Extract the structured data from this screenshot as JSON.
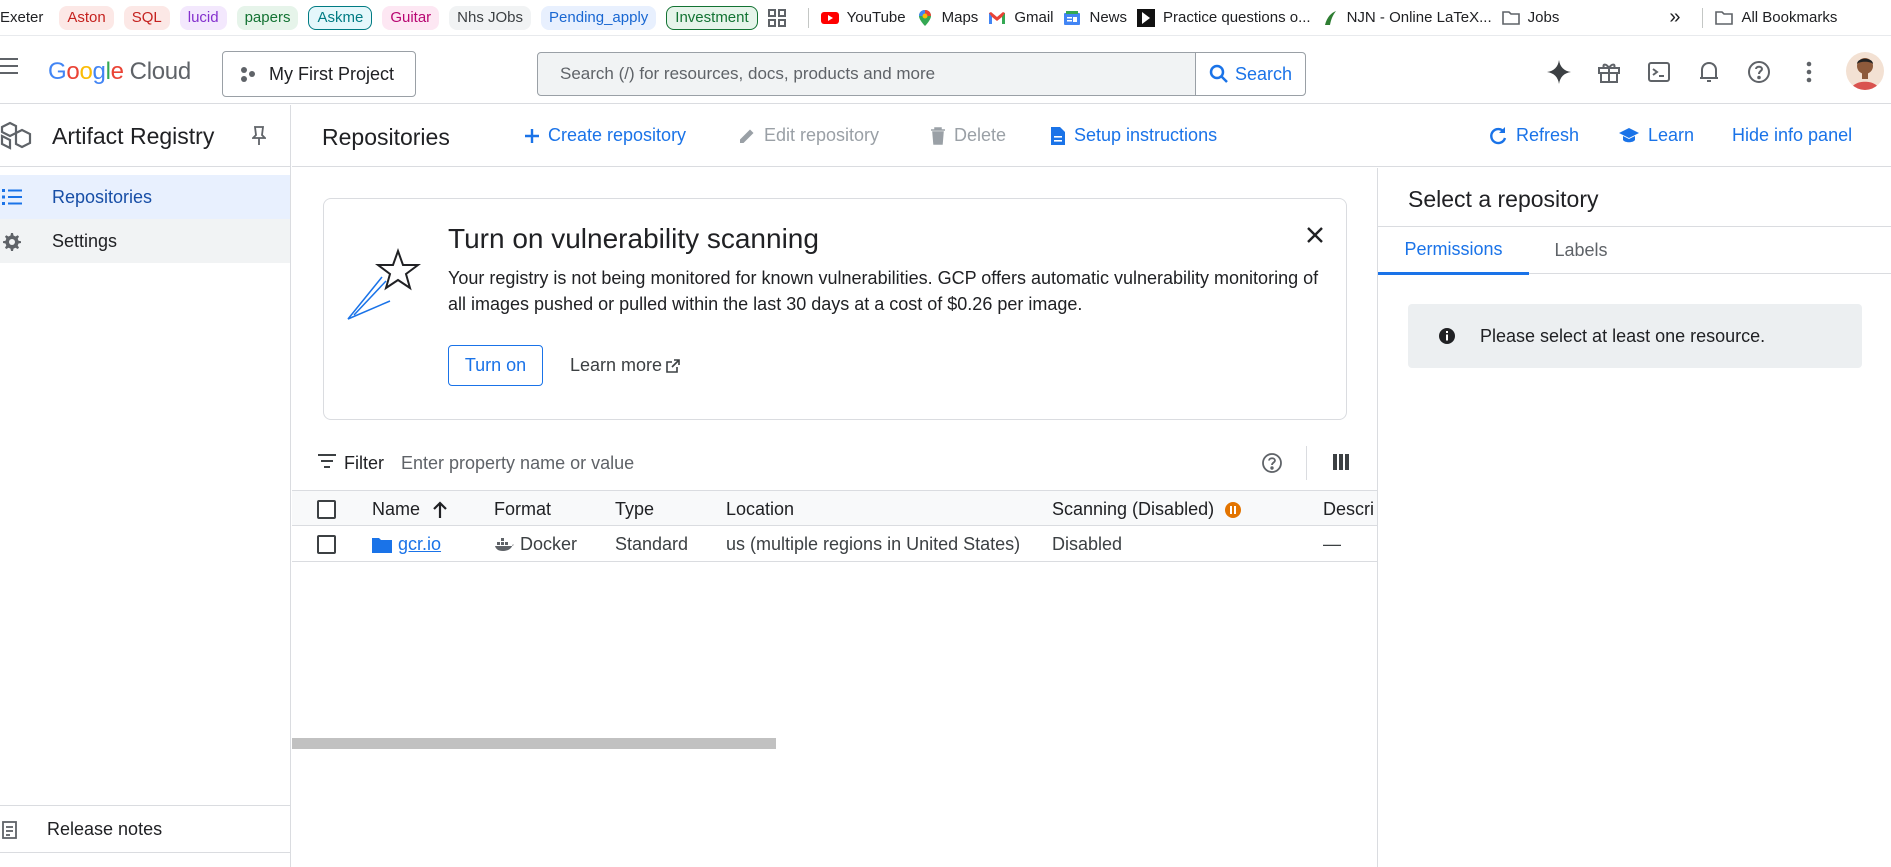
{
  "bookmarks": {
    "items": [
      {
        "label": "Exeter",
        "color": "",
        "bg": "",
        "border": ""
      },
      {
        "label": "Aston",
        "color": "#c5221f",
        "bg": "#fce8e6",
        "border": ""
      },
      {
        "label": "SQL",
        "color": "#c5221f",
        "bg": "#fce8e6",
        "border": ""
      },
      {
        "label": "lucid",
        "color": "#8430ce",
        "bg": "#f3e8fd",
        "border": ""
      },
      {
        "label": "papers",
        "color": "#137333",
        "bg": "#e6f4ea",
        "border": ""
      },
      {
        "label": "Askme",
        "color": "#007b83",
        "bg": "#e4f7fb",
        "border": "#007b83"
      },
      {
        "label": "Guitar",
        "color": "#b80672",
        "bg": "#fde7f3",
        "border": ""
      },
      {
        "label": "Nhs JObs",
        "color": "#3c4043",
        "bg": "#f1f3f4",
        "border": ""
      },
      {
        "label": "Pending_apply",
        "color": "#1967d2",
        "bg": "#e8f0fe",
        "border": ""
      },
      {
        "label": "Investment",
        "color": "#137333",
        "bg": "#e6f4ea",
        "border": "#137333"
      }
    ],
    "links": [
      {
        "label": "YouTube",
        "icon": "youtube-icon"
      },
      {
        "label": "Maps",
        "icon": "maps-icon"
      },
      {
        "label": "Gmail",
        "icon": "gmail-icon"
      },
      {
        "label": "News",
        "icon": "news-icon"
      },
      {
        "label": "Practice questions o...",
        "icon": "practice-icon"
      },
      {
        "label": "NJN - Online LaTeX...",
        "icon": "latex-icon"
      },
      {
        "label": "Jobs",
        "icon": "folder-icon"
      }
    ],
    "more": "»",
    "all_bookmarks": "All Bookmarks"
  },
  "header": {
    "logo_google": [
      "G",
      "o",
      "o",
      "g",
      "l",
      "e"
    ],
    "logo_cloud": "Cloud",
    "project": "My First Project",
    "search_placeholder": "Search (/) for resources, docs, products and more",
    "search_button": "Search"
  },
  "sidebar": {
    "product": "Artifact Registry",
    "items": [
      {
        "label": "Repositories",
        "icon": "list-icon",
        "active": true
      },
      {
        "label": "Settings",
        "icon": "gear-icon",
        "active": false
      }
    ],
    "release_notes": "Release notes"
  },
  "toolbar": {
    "title": "Repositories",
    "create": "Create repository",
    "edit": "Edit repository",
    "delete": "Delete",
    "setup": "Setup instructions",
    "refresh": "Refresh",
    "learn": "Learn",
    "hide_panel": "Hide info panel"
  },
  "banner": {
    "title": "Turn on vulnerability scanning",
    "body": "Your registry is not being monitored for known vulnerabilities. GCP offers automatic vulnerability monitoring of all images pushed or pulled within the last 30 days at a cost of $0.26 per image.",
    "turn_on": "Turn on",
    "learn_more": "Learn more"
  },
  "filter": {
    "label": "Filter",
    "placeholder": "Enter property name or value"
  },
  "table": {
    "columns": [
      "Name",
      "Format",
      "Type",
      "Location",
      "Scanning (Disabled)",
      "Descri"
    ],
    "rows": [
      {
        "name": "gcr.io",
        "format": "Docker",
        "type": "Standard",
        "location": "us (multiple regions in United States)",
        "scanning": "Disabled",
        "description": "—"
      }
    ]
  },
  "info_panel": {
    "title": "Select a repository",
    "tabs": [
      "Permissions",
      "Labels"
    ],
    "message": "Please select at least one resource."
  },
  "colors": {
    "accent": "#1a73e8",
    "active_nav_bg": "#e8f0fe",
    "scan_badge": "#e37400"
  }
}
